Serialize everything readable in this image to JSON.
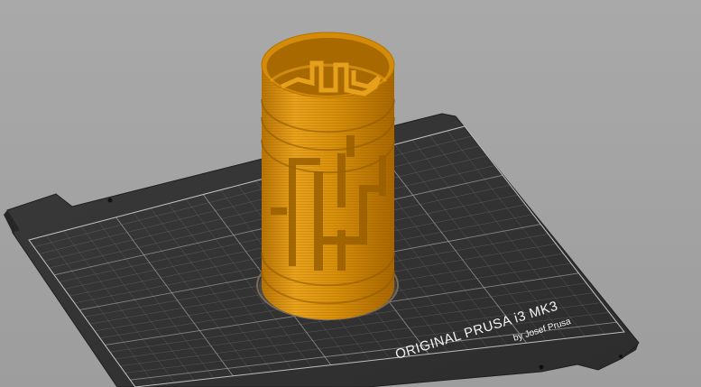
{
  "app": {
    "view": "3D slicer preview"
  },
  "bed": {
    "brand_line": "ORIGINAL PRUSA i3  MK3",
    "byline": "by Josef Prusa",
    "color_sheet": "#2f2f2f",
    "color_grid": "#9a9a9a"
  },
  "model": {
    "color": "#d8900a",
    "shadow_color": "#8f5b00"
  }
}
